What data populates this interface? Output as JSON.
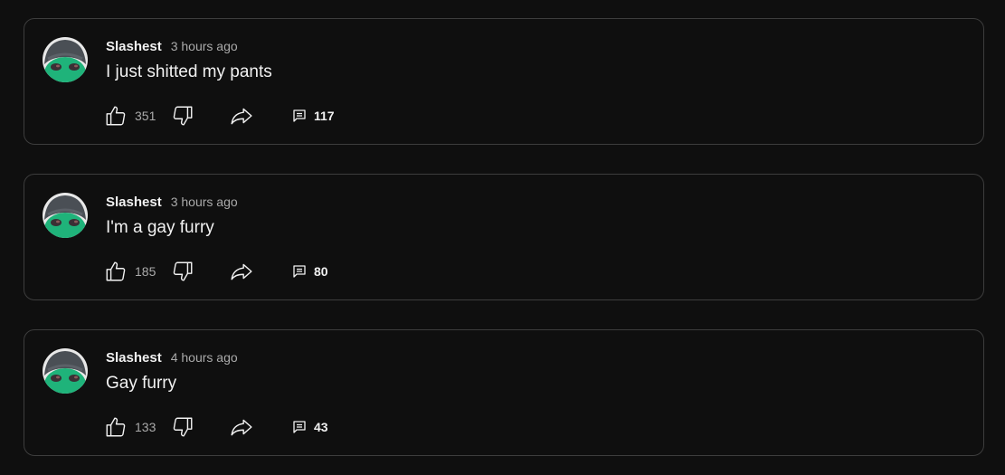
{
  "posts": [
    {
      "author": "Slashest",
      "time": "3 hours ago",
      "text": "I just shitted my pants",
      "likes": "351",
      "replies": "117",
      "avatar_icon": "avatar-green-face-beanie"
    },
    {
      "author": "Slashest",
      "time": "3 hours ago",
      "text": "I'm a gay furry",
      "likes": "185",
      "replies": "80",
      "avatar_icon": "avatar-green-face-beanie"
    },
    {
      "author": "Slashest",
      "time": "4 hours ago",
      "text": "Gay furry",
      "likes": "133",
      "replies": "43",
      "avatar_icon": "avatar-green-face-beanie"
    }
  ],
  "icons": {
    "like": "thumbs-up-icon",
    "dislike": "thumbs-down-icon",
    "share": "share-arrow-icon",
    "replies": "comment-icon"
  },
  "colors": {
    "background": "#0f0f0f",
    "border": "#3d3d3d",
    "text_primary": "#f1f1f1",
    "text_secondary": "#aaaaaa",
    "avatar_face": "#1fb37a",
    "avatar_hat": "#4a4f55"
  }
}
